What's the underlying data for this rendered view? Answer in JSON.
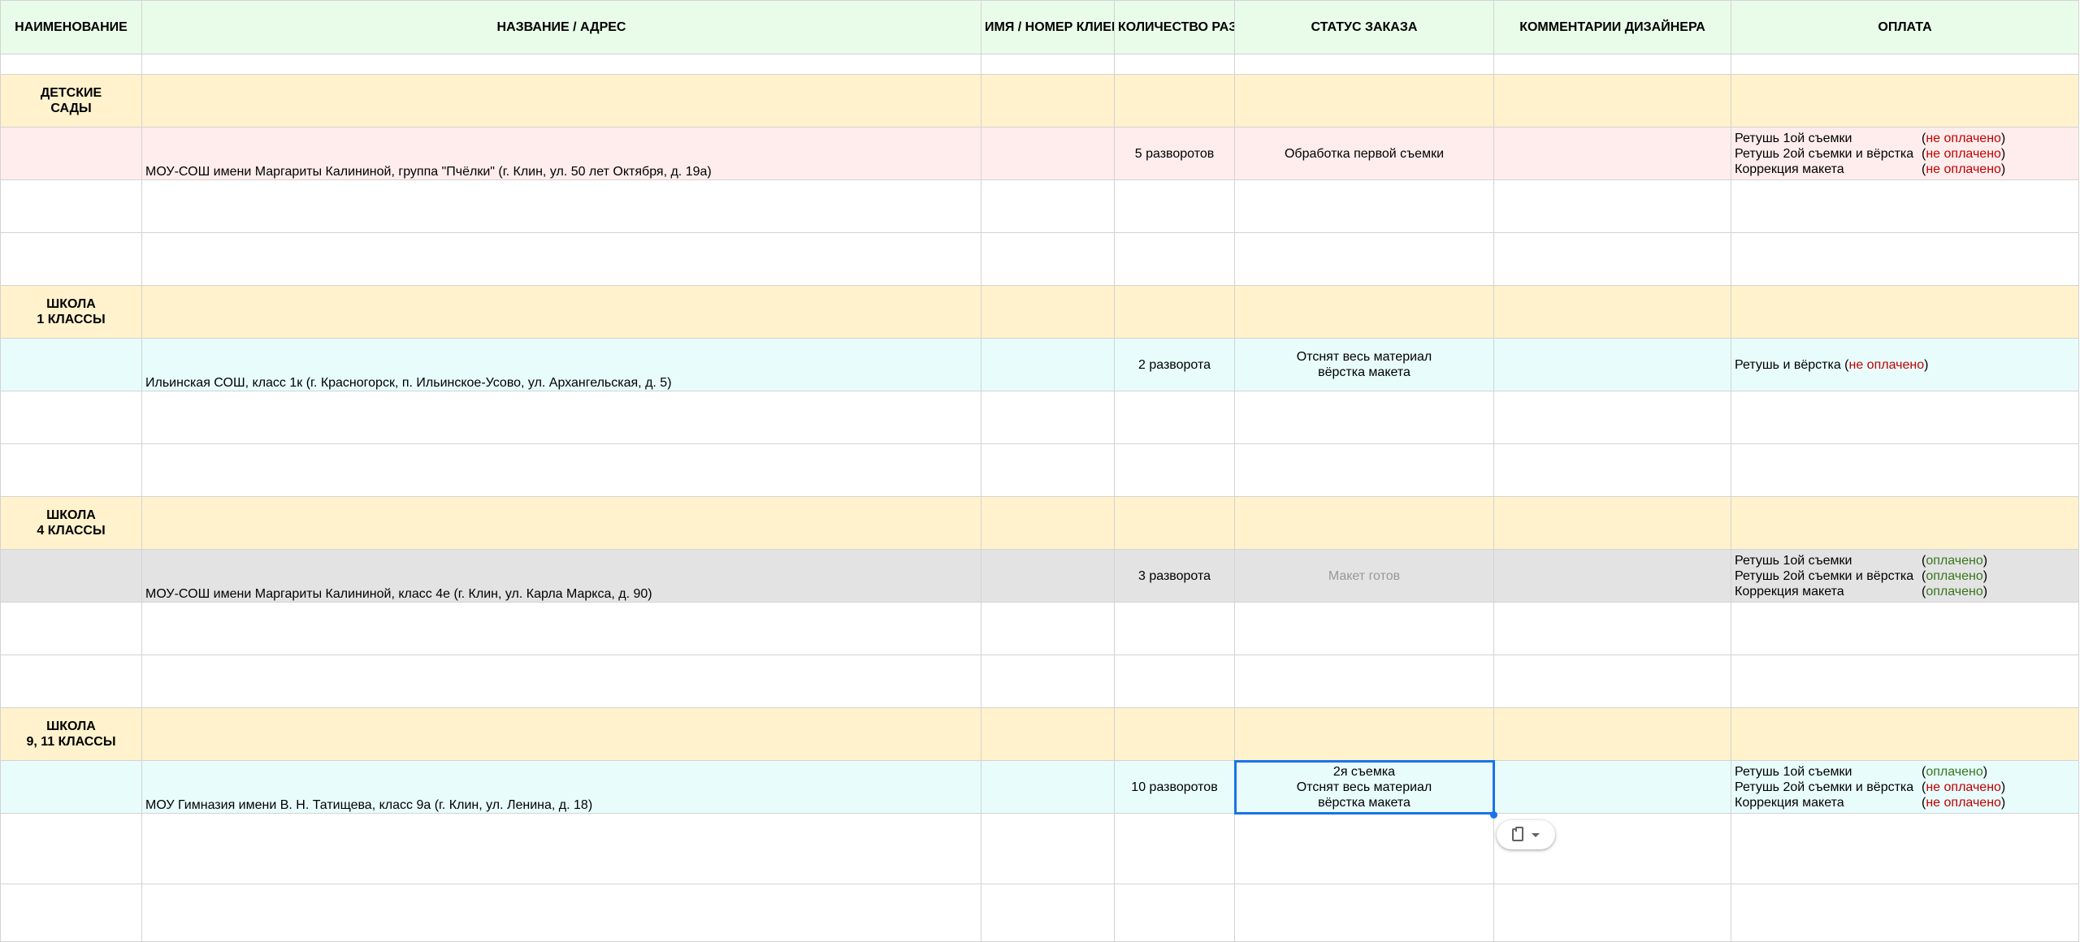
{
  "headers": {
    "name": "НАИМЕНОВАНИЕ",
    "address": "НАЗВАНИЕ / АДРЕС",
    "client": "ИМЯ / НОМЕР КЛИЕНТА",
    "spreads": "КОЛИЧЕСТВО РАЗВОРОТОВ",
    "status": "СТАТУС ЗАКАЗА",
    "comments": "КОММЕНТАРИИ ДИЗАЙНЕРА",
    "payment": "ОПЛАТА"
  },
  "categories": [
    {
      "name": "ДЕТСКИЕ САДЫ"
    },
    {
      "name": "ШКОЛА 1 КЛАССЫ"
    },
    {
      "name": "ШКОЛА 4 КЛАССЫ"
    },
    {
      "name": "ШКОЛА 9, 11 КЛАССЫ"
    }
  ],
  "orders": [
    {
      "address": "МОУ-СОШ имени Маргариты Калининой, группа \"Пчёлки\" (г. Клин, ул. 50 лет Октября, д. 19а)",
      "spreads": "5 разворотов",
      "status": [
        "Обработка первой съемки"
      ],
      "payments": [
        {
          "label": "Ретушь 1ой съемки",
          "open": "(",
          "state": "не оплачено",
          "close": ")"
        },
        {
          "label": "Ретушь 2ой съемки и вёрстка",
          "open": "(",
          "state": "не оплачено",
          "close": ")"
        },
        {
          "label": "Коррекция макета",
          "open": "(",
          "state": "не оплачено",
          "close": ")"
        }
      ]
    },
    {
      "address": "Ильинская СОШ, класс 1к (г. Красногорск, п. Ильинское-Усово, ул. Архангельская, д. 5)",
      "spreads": "2 разворота",
      "status": [
        "Отснят весь материал",
        "вёрстка макета"
      ],
      "payment_inline": {
        "label": "Ретушь и вёрстка (",
        "state": "не оплачено",
        "close": ")"
      }
    },
    {
      "address": "МОУ-СОШ имени Маргариты Калининой, класс 4е (г. Клин, ул. Карла Маркса, д. 90)",
      "spreads": "3 разворота",
      "status": [
        "Макет готов"
      ],
      "payments": [
        {
          "label": "Ретушь 1ой съемки",
          "open": "(",
          "state": "оплачено",
          "close": ")"
        },
        {
          "label": "Ретушь 2ой съемки и вёрстка",
          "open": "(",
          "state": "оплачено",
          "close": ")"
        },
        {
          "label": "Коррекция макета",
          "open": "(",
          "state": "оплачено",
          "close": ")"
        }
      ]
    },
    {
      "address": "МОУ Гимназия имени В. Н. Татищева, класс 9а (г. Клин, ул. Ленина, д. 18)",
      "spreads": "10 разворотов",
      "status": [
        "2я съемка",
        "Отснят весь материал",
        "вёрстка макета"
      ],
      "payments": [
        {
          "label": "Ретушь 1ой съемки",
          "open": "(",
          "state": "оплачено",
          "close": ")"
        },
        {
          "label": "Ретушь 2ой съемки и вёрстка",
          "open": "(",
          "state": "не оплачено",
          "close": ")"
        },
        {
          "label": "Коррекция макета",
          "open": "(",
          "state": "не оплачено",
          "close": ")"
        }
      ]
    }
  ],
  "colors": {
    "header_bg": "#e9fce9",
    "category_bg": "#fff2cc",
    "pink_row": "#ffeded",
    "cyan_row": "#e8fcfc",
    "grey_row": "#e3e3e3",
    "unpaid": "#c00000",
    "paid": "#38761d",
    "selection": "#1a73e8"
  },
  "icons": {
    "paste": "clipboard-icon",
    "dropdown": "chevron-down-icon"
  }
}
